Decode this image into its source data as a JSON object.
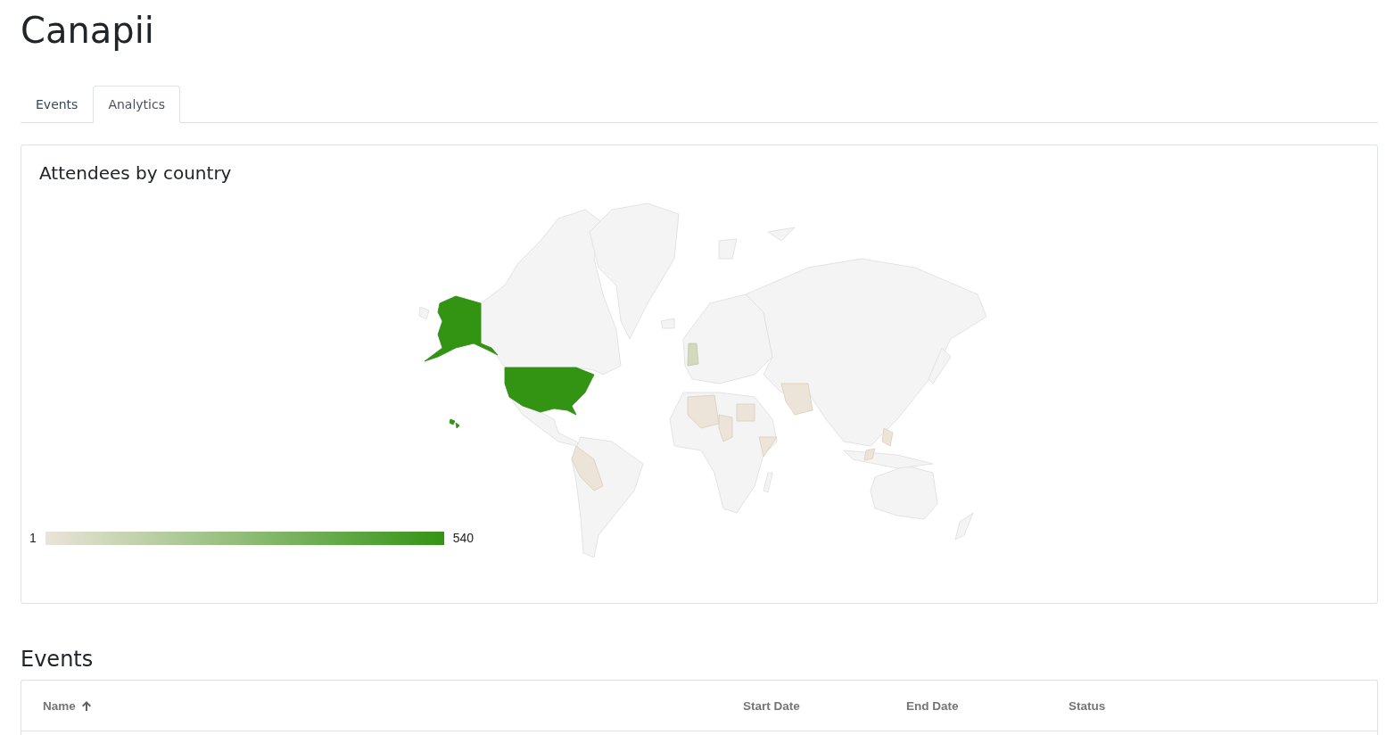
{
  "app": {
    "title": "Canapii"
  },
  "tabs": [
    {
      "label": "Events",
      "selected": false
    },
    {
      "label": "Analytics",
      "selected": true
    }
  ],
  "attendees_card": {
    "title": "Attendees by country",
    "legend": {
      "min": "1",
      "max": "540"
    }
  },
  "events": {
    "heading": "Events",
    "columns": [
      {
        "label": "Name",
        "sorted": true
      },
      {
        "label": "Start Date",
        "sorted": false
      },
      {
        "label": "End Date",
        "sorted": false
      },
      {
        "label": "Status",
        "sorted": false
      }
    ]
  }
}
